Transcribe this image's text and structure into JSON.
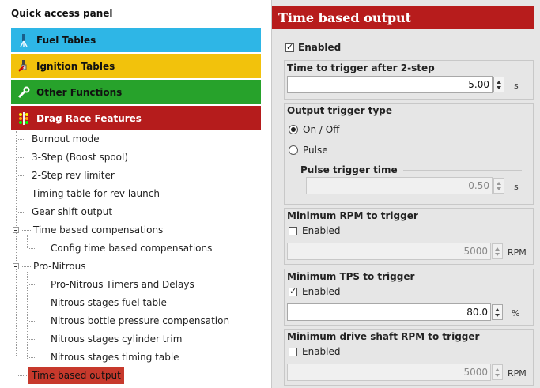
{
  "left_panel": {
    "title": "Quick access panel",
    "categories": [
      {
        "label": "Fuel Tables",
        "icon": "fuel-injector-icon",
        "color": "#2eb6e6"
      },
      {
        "label": "Ignition Tables",
        "icon": "spark-plug-icon",
        "color": "#f2c20c"
      },
      {
        "label": "Other Functions",
        "icon": "wrench-icon",
        "color": "#27a22b"
      },
      {
        "label": "Drag Race Features",
        "icon": "drag-tree-icon",
        "color": "#b51c1c"
      }
    ],
    "tree": [
      "Burnout mode",
      "3-Step (Boost spool)",
      "2-Step rev limiter",
      "Timing table for rev launch",
      "Gear shift output",
      "Time based compensations",
      "Config time based compensations",
      "Pro-Nitrous",
      "Pro-Nitrous Timers and Delays",
      "Nitrous stages fuel table",
      "Nitrous bottle pressure compensation",
      "Nitrous stages cylinder trim",
      "Nitrous stages timing table",
      "Time based output"
    ],
    "selected": "Time based output"
  },
  "right_panel": {
    "title": "Time based output",
    "enabled_label": "Enabled",
    "enabled_checked": true,
    "time_trigger": {
      "title": "Time to trigger after 2-step",
      "value": "5.00",
      "unit": "s"
    },
    "output_type": {
      "title": "Output trigger type",
      "option_onoff": "On / Off",
      "option_pulse": "Pulse",
      "selected": "On / Off",
      "pulse_time_label": "Pulse trigger time",
      "pulse_time_value": "0.50",
      "pulse_time_unit": "s"
    },
    "min_rpm": {
      "title": "Minimum RPM to trigger",
      "enabled_label": "Enabled",
      "enabled_checked": false,
      "value": "5000",
      "unit": "RPM"
    },
    "min_tps": {
      "title": "Minimum TPS to trigger",
      "enabled_label": "Enabled",
      "enabled_checked": true,
      "value": "80.0",
      "unit": "%"
    },
    "min_drive": {
      "title": "Minimum drive shaft RPM to trigger",
      "enabled_label": "Enabled",
      "enabled_checked": false,
      "value": "5000",
      "unit": "RPM"
    }
  }
}
